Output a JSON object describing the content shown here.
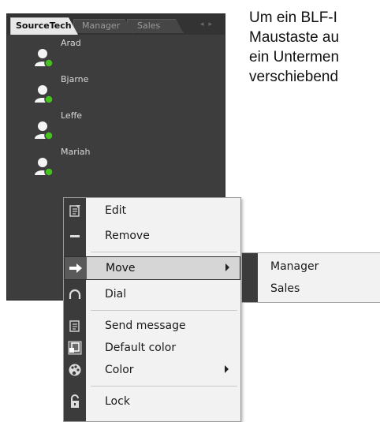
{
  "panel": {
    "tabs": [
      "SourceTech",
      "Manager",
      "Sales"
    ],
    "contacts": [
      "Arad",
      "Bjarne",
      "Leffe",
      "Mariah"
    ]
  },
  "context_menu": {
    "items": [
      {
        "label": "Edit",
        "icon": "edit-icon"
      },
      {
        "label": "Remove",
        "icon": "remove-icon"
      },
      {
        "label": "Move",
        "icon": "arrow-right-icon",
        "submenu": true,
        "highlighted": true
      },
      {
        "label": "Dial",
        "icon": "headset-icon"
      },
      {
        "label": "Send message",
        "icon": "message-icon"
      },
      {
        "label": "Default color",
        "icon": "default-color-icon"
      },
      {
        "label": "Color",
        "icon": "palette-icon",
        "submenu": true
      },
      {
        "label": "Lock",
        "icon": "lock-icon"
      }
    ]
  },
  "move_submenu": {
    "items": [
      "Manager",
      "Sales"
    ]
  },
  "help_text": {
    "lines": [
      "Um ein BLF-I",
      "Maustaste au",
      "ein Untermen",
      "verschiebend"
    ]
  },
  "colors": {
    "panel_bg": "#3d3d3d",
    "presence_green": "#45c21f",
    "menu_bg": "#f2f2f2",
    "gutter": "#3b3b3b"
  }
}
